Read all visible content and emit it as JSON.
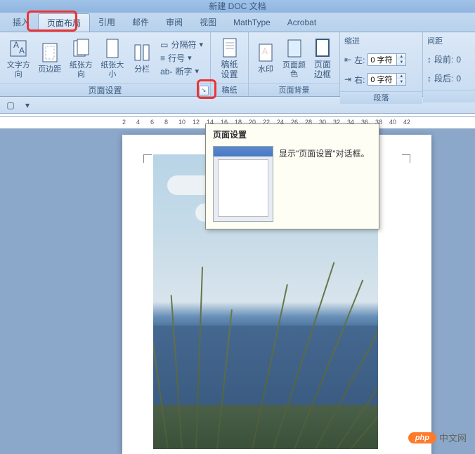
{
  "title": "新建 DOC 文档",
  "tabs": {
    "insert": "插入",
    "layout": "页面布局",
    "references": "引用",
    "mailings": "邮件",
    "review": "审阅",
    "view": "视图",
    "mathtype": "MathType",
    "acrobat": "Acrobat"
  },
  "ribbon": {
    "page_setup": {
      "label": "页面设置",
      "text_direction": "文字方向",
      "margins": "页边距",
      "orientation": "纸张方向",
      "size": "纸张大小",
      "columns": "分栏",
      "breaks": "分隔符",
      "line_numbers": "行号",
      "hyphenation": "断字"
    },
    "manuscript": {
      "label": "稿纸",
      "settings_l1": "稿纸",
      "settings_l2": "设置"
    },
    "background": {
      "label": "页面背景",
      "watermark": "水印",
      "color": "页面颜色",
      "borders_l1": "页面",
      "borders_l2": "边框"
    },
    "indent": {
      "label": "缩进",
      "left": "左:",
      "right": "右:",
      "left_val": "0 字符",
      "right_val": "0 字符"
    },
    "spacing": {
      "label": "间距",
      "before": "段前:",
      "after": "段后:",
      "before_val": "0",
      "after_val": "0"
    },
    "paragraph_label": "段落"
  },
  "tooltip": {
    "title": "页面设置",
    "text": "显示\"页面设置\"对话框。"
  },
  "ruler_ticks": [
    "2",
    "4",
    "6",
    "8",
    "10",
    "12",
    "14",
    "16",
    "18",
    "20",
    "22",
    "24",
    "26",
    "28",
    "30",
    "32",
    "34",
    "36",
    "38",
    "40",
    "42"
  ],
  "watermark": {
    "pill": "php",
    "text": "中文网"
  }
}
